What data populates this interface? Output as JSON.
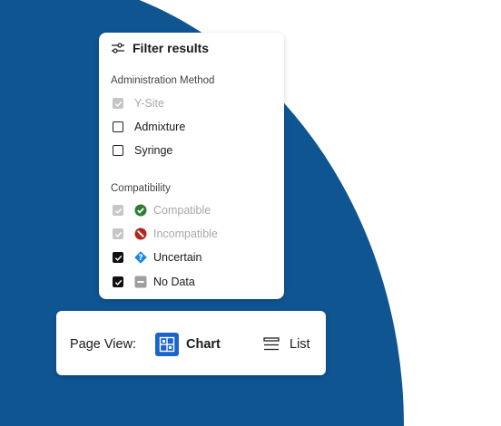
{
  "filter": {
    "title": "Filter results",
    "administration_method": {
      "label": "Administration Method",
      "options": [
        {
          "label": "Y-Site",
          "checked": true,
          "disabled": true
        },
        {
          "label": "Admixture",
          "checked": false,
          "disabled": false
        },
        {
          "label": "Syringe",
          "checked": false,
          "disabled": false
        }
      ]
    },
    "compatibility": {
      "label": "Compatibility",
      "options": [
        {
          "label": "Compatible",
          "checked": true,
          "disabled": true,
          "icon": "check-circle-icon",
          "color": "#2e7d32"
        },
        {
          "label": "Incompatible",
          "checked": true,
          "disabled": true,
          "icon": "no-entry-icon",
          "color": "#b3261e"
        },
        {
          "label": "Uncertain",
          "checked": true,
          "disabled": false,
          "icon": "question-diamond-icon",
          "color": "#1e88e5"
        },
        {
          "label": "No Data",
          "checked": true,
          "disabled": false,
          "icon": "minus-square-icon",
          "color": "#9e9e9e"
        }
      ]
    }
  },
  "page_view": {
    "label": "Page View:",
    "chart_label": "Chart",
    "list_label": "List",
    "selected": "Chart"
  },
  "colors": {
    "background_shape": "#0f5592",
    "accent": "#1b64c9"
  }
}
